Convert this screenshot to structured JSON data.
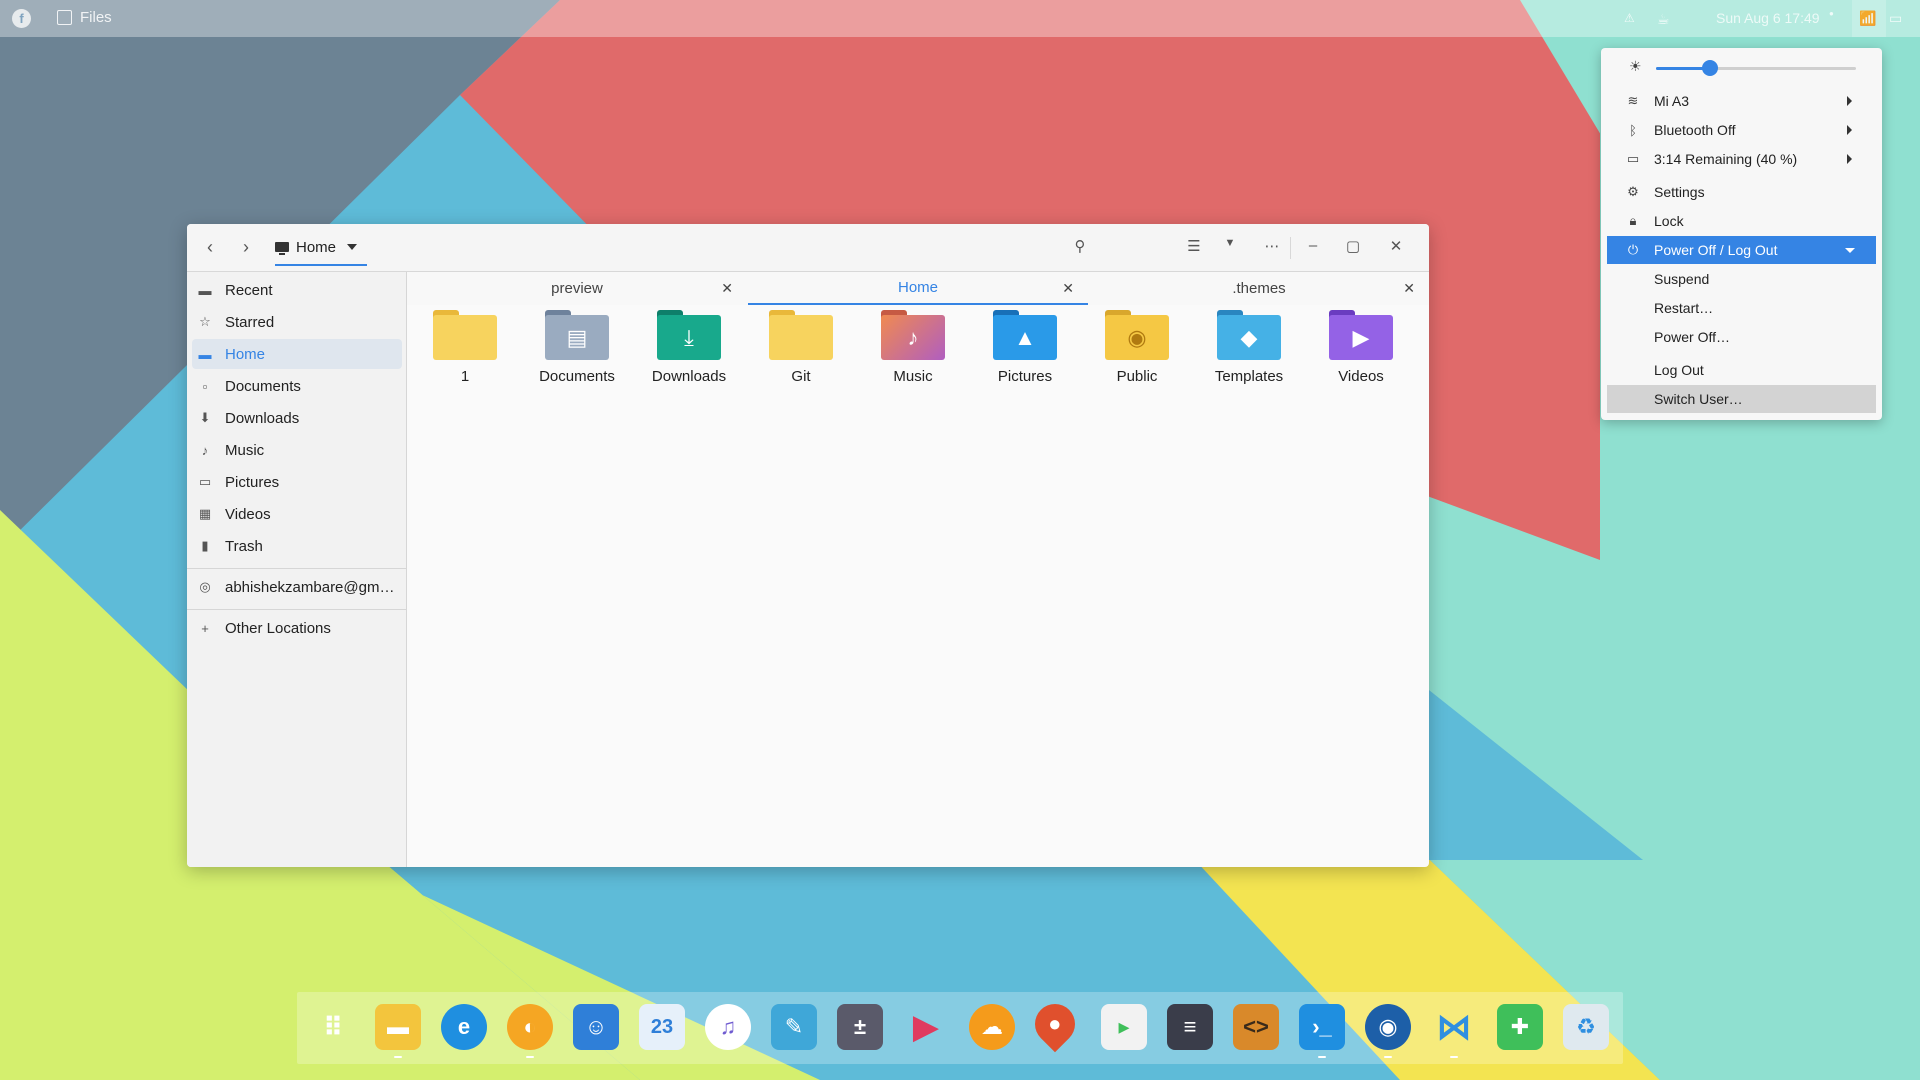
{
  "topbar": {
    "app_name": "Files",
    "clock": "Sun Aug 6 17:49"
  },
  "window": {
    "path_label": "Home",
    "sidebar": {
      "items": [
        {
          "label": "Recent",
          "icon": "clock-icon"
        },
        {
          "label": "Starred",
          "icon": "star-icon"
        },
        {
          "label": "Home",
          "icon": "home-icon"
        },
        {
          "label": "Documents",
          "icon": "document-icon"
        },
        {
          "label": "Downloads",
          "icon": "download-icon"
        },
        {
          "label": "Music",
          "icon": "music-icon"
        },
        {
          "label": "Pictures",
          "icon": "picture-icon"
        },
        {
          "label": "Videos",
          "icon": "video-icon"
        },
        {
          "label": "Trash",
          "icon": "trash-icon"
        }
      ],
      "network": "abhishekzambare@gm…",
      "other": "Other Locations"
    },
    "tabs": [
      {
        "label": "preview"
      },
      {
        "label": "Home"
      },
      {
        "label": ".themes"
      }
    ],
    "files": [
      {
        "name": "1",
        "color": "#f7cc4a"
      },
      {
        "name": "Documents",
        "color": "#8d9fb6"
      },
      {
        "name": "Downloads",
        "color": "#14a084"
      },
      {
        "name": "Git",
        "color": "#f7cc4a"
      },
      {
        "name": "Music",
        "color": "#e26f56"
      },
      {
        "name": "Pictures",
        "color": "#1f8fe0"
      },
      {
        "name": "Public",
        "color": "#f3c53d"
      },
      {
        "name": "Templates",
        "color": "#38a7e0"
      },
      {
        "name": "Videos",
        "color": "#8b55e0"
      }
    ]
  },
  "menu": {
    "brightness": 0.27,
    "wifi": "Mi A3",
    "bluetooth": "Bluetooth Off",
    "battery": "3:14 Remaining (40 %)",
    "settings": "Settings",
    "lock": "Lock",
    "power": "Power Off / Log Out",
    "suspend": "Suspend",
    "restart": "Restart…",
    "poweroff": "Power Off…",
    "logout": "Log Out",
    "switchuser": "Switch User…"
  },
  "dock": {
    "apps": [
      {
        "name": "app-grid-icon",
        "color": "transparent"
      },
      {
        "name": "files-icon",
        "color": "#f3c53d"
      },
      {
        "name": "edge-browser-icon",
        "color": "#1f8fe0"
      },
      {
        "name": "firefox-icon",
        "color": "#f5a623"
      },
      {
        "name": "people-icon",
        "color": "#2f7fd8"
      },
      {
        "name": "calendar-icon",
        "color": "#2f7fd8"
      },
      {
        "name": "music-player-icon",
        "color": "#6f5bd0"
      },
      {
        "name": "image-editor-icon",
        "color": "#3fa7d8"
      },
      {
        "name": "calculator-icon",
        "color": "#5a5a6a"
      },
      {
        "name": "media-player-icon",
        "color": "#e03a5f"
      },
      {
        "name": "weather-icon",
        "color": "#f59b1b"
      },
      {
        "name": "maps-icon",
        "color": "#e0502d"
      },
      {
        "name": "store-icon",
        "color": "#f2f2f2"
      },
      {
        "name": "tweaks-icon",
        "color": "#3a3d4a"
      },
      {
        "name": "code-editor-icon",
        "color": "#d9892a"
      },
      {
        "name": "terminal-icon",
        "color": "#1f8fe0"
      },
      {
        "name": "disk-icon",
        "color": "#1d5fa8"
      },
      {
        "name": "vscode-icon",
        "color": "#2f8fe0"
      },
      {
        "name": "extensions-icon",
        "color": "#3fbf5a"
      },
      {
        "name": "recycle-bin-icon",
        "color": "#dfe9ef"
      }
    ],
    "calendar_day": "23"
  }
}
